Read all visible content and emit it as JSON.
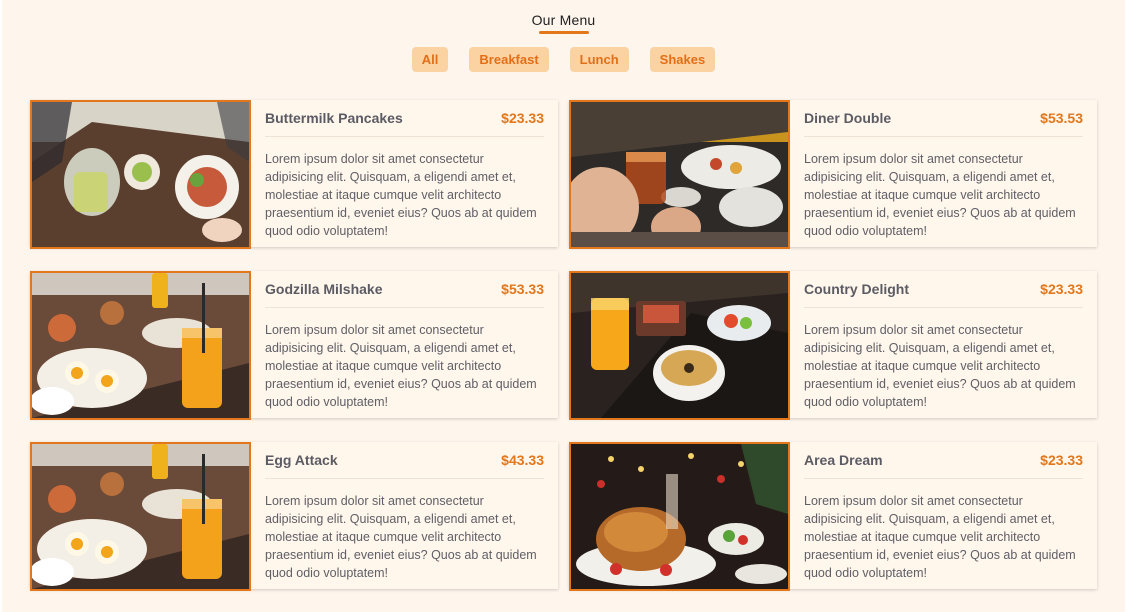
{
  "header": {
    "title": "Our Menu"
  },
  "filters": [
    "All",
    "Breakfast",
    "Lunch",
    "Shakes"
  ],
  "menu": [
    {
      "name": "Buttermilk Pancakes",
      "price": "$23.33",
      "image": "pancakes-table-photo",
      "desc": "Lorem ipsum dolor sit amet consectetur adipisicing elit. Quisquam, a eligendi amet et, molestiae at itaque cumque velit architecto praesentium id, eveniet eius? Quos ab at quidem quod odio voluptatem!"
    },
    {
      "name": "Diner Double",
      "price": "$53.53",
      "image": "tea-glass-photo",
      "desc": "Lorem ipsum dolor sit amet consectetur adipisicing elit. Quisquam, a eligendi amet et, molestiae at itaque cumque velit architecto praesentium id, eveniet eius? Quos ab at quidem quod odio voluptatem!"
    },
    {
      "name": "Godzilla Milshake",
      "price": "$53.33",
      "image": "breakfast-spread-photo",
      "desc": "Lorem ipsum dolor sit amet consectetur adipisicing elit. Quisquam, a eligendi amet et, molestiae at itaque cumque velit architecto praesentium id, eveniet eius? Quos ab at quidem quod odio voluptatem!"
    },
    {
      "name": "Country Delight",
      "price": "$23.33",
      "image": "soup-juice-photo",
      "desc": "Lorem ipsum dolor sit amet consectetur adipisicing elit. Quisquam, a eligendi amet et, molestiae at itaque cumque velit architecto praesentium id, eveniet eius? Quos ab at quidem quod odio voluptatem!"
    },
    {
      "name": "Egg Attack",
      "price": "$43.33",
      "image": "breakfast-spread-photo",
      "desc": "Lorem ipsum dolor sit amet consectetur adipisicing elit. Quisquam, a eligendi amet et, molestiae at itaque cumque velit architecto praesentium id, eveniet eius? Quos ab at quidem quod odio voluptatem!"
    },
    {
      "name": "Area Dream",
      "price": "$23.33",
      "image": "roast-chicken-photo",
      "desc": "Lorem ipsum dolor sit amet consectetur adipisicing elit. Quisquam, a eligendi amet et, molestiae at itaque cumque velit architecto praesentium id, eveniet eius? Quos ab at quidem quod odio voluptatem!"
    }
  ],
  "colors": {
    "accent": "#e2771c",
    "background": "#fef6ec",
    "button_bg": "#fbd3a3"
  }
}
